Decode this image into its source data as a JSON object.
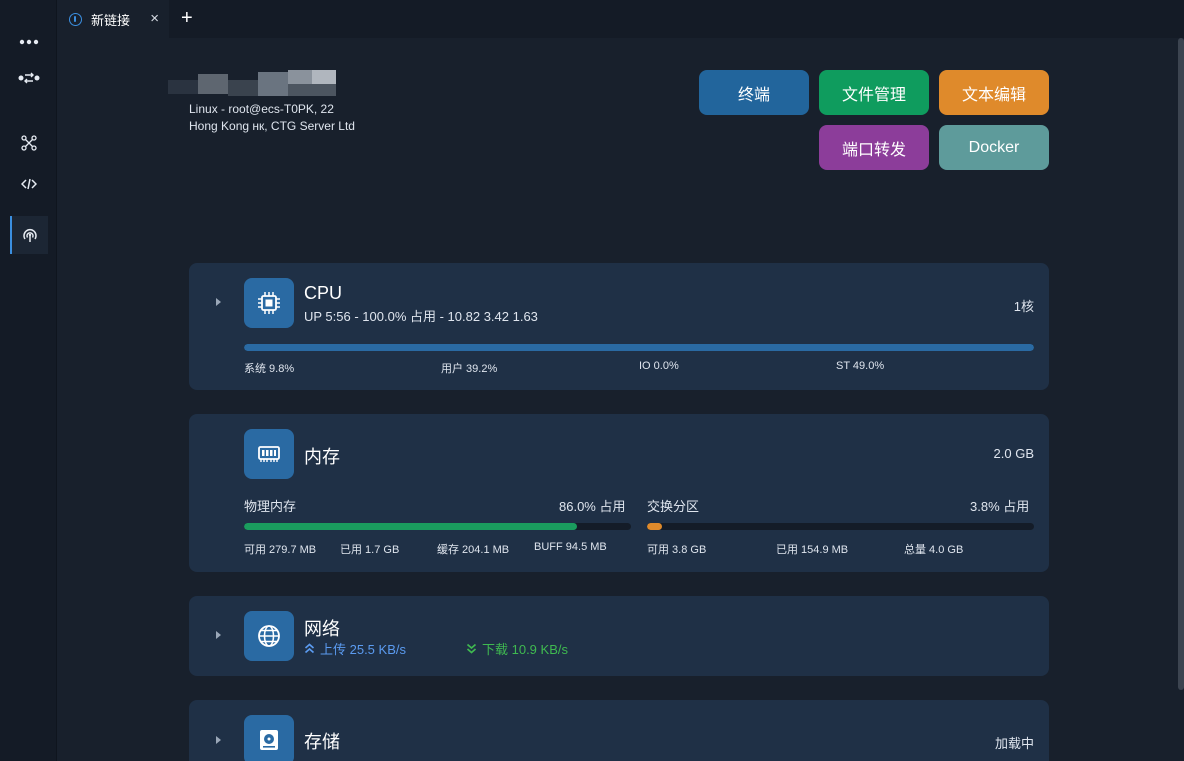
{
  "tab": {
    "title": "新链接",
    "close": "×",
    "add": "+"
  },
  "host": {
    "line1": "Linux - root@ecs-T0PK, 22",
    "line2": "Hong Kong нк, CTG Server Ltd"
  },
  "actions": {
    "terminal": "终端",
    "file_manager": "文件管理",
    "text_editor": "文本编辑",
    "port_forward": "端口转发",
    "docker": "Docker"
  },
  "colors": {
    "terminal": "#22659c",
    "file_manager": "#0f9c5e",
    "text_editor": "#df8a2b",
    "port_forward": "#8c3d9a",
    "docker": "#5e9b9b",
    "cpu_bar": "#2a6aa3",
    "mem_bar": "#1a9c5e",
    "swap_bar": "#df8a2b",
    "upload": "#5b9bf0",
    "download": "#3fb950"
  },
  "cpu": {
    "title": "CPU",
    "subtitle": "UP 5:56 - 100.0% 占用 - 10.82 3.42 1.63",
    "cores": "1核",
    "usage_fraction": 1.0,
    "stats": [
      "系统 9.8%",
      "用户 39.2%",
      "IO 0.0%",
      "ST 49.0%"
    ]
  },
  "memory": {
    "title": "内存",
    "total": "2.0 GB",
    "physical_label": "物理内存",
    "physical_usage": "86.0% 占用",
    "physical_fraction": 0.86,
    "swap_label": "交换分区",
    "swap_usage": "3.8% 占用",
    "swap_fraction": 0.038,
    "physical_stats": [
      "可用 279.7 MB",
      "已用 1.7 GB",
      "缓存 204.1 MB",
      "BUFF 94.5 MB"
    ],
    "swap_stats": [
      "可用 3.8 GB",
      "已用 154.9 MB",
      "总量 4.0 GB"
    ]
  },
  "network": {
    "title": "网络",
    "upload": "上传 25.5 KB/s",
    "download": "下载 10.9 KB/s"
  },
  "storage": {
    "title": "存储",
    "status": "加载中"
  }
}
